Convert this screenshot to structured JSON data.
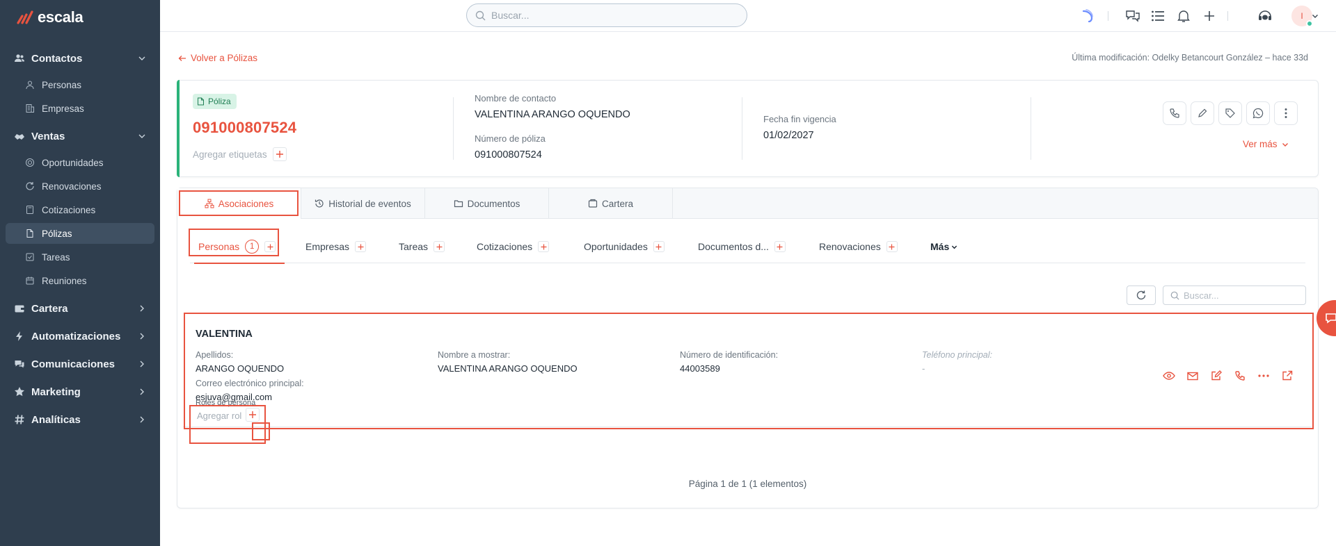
{
  "app": {
    "brand": "escala"
  },
  "search_top": {
    "placeholder": "Buscar..."
  },
  "sidebar": {
    "sections": [
      {
        "label": "Contactos",
        "icon": "users-icon",
        "expanded": true,
        "items": [
          {
            "label": "Personas",
            "icon": "user-icon"
          },
          {
            "label": "Empresas",
            "icon": "building-icon"
          }
        ]
      },
      {
        "label": "Ventas",
        "icon": "handshake-icon",
        "expanded": true,
        "items": [
          {
            "label": "Oportunidades",
            "icon": "target-icon"
          },
          {
            "label": "Renovaciones",
            "icon": "refresh-icon"
          },
          {
            "label": "Cotizaciones",
            "icon": "calculator-icon"
          },
          {
            "label": "Pólizas",
            "icon": "document-icon",
            "active": true
          },
          {
            "label": "Tareas",
            "icon": "checkbox-icon"
          },
          {
            "label": "Reuniones",
            "icon": "calendar-icon"
          }
        ]
      },
      {
        "label": "Cartera",
        "icon": "wallet-icon",
        "expanded": false,
        "items": []
      },
      {
        "label": "Automatizaciones",
        "icon": "bolt-icon",
        "expanded": false,
        "items": []
      },
      {
        "label": "Comunicaciones",
        "icon": "chat-icon",
        "expanded": false,
        "items": []
      },
      {
        "label": "Marketing",
        "icon": "star-icon",
        "expanded": false,
        "items": []
      },
      {
        "label": "Analíticas",
        "icon": "hash-icon",
        "expanded": false,
        "items": []
      }
    ]
  },
  "topbar": {
    "avatar_initial": "I"
  },
  "page": {
    "back_label": "Volver a Pólizas",
    "last_modified": "Última modificación: Odelky Betancourt González – hace 33d"
  },
  "policy": {
    "badge": "Póliza",
    "number_title": "091000807524",
    "add_tags": "Agregar etiquetas",
    "contact_label": "Nombre de contacto",
    "contact_value": "VALENTINA ARANGO OQUENDO",
    "policy_number_label": "Número de póliza",
    "policy_number_value": "091000807524",
    "end_date_label": "Fecha fin vigencia",
    "end_date_value": "01/02/2027",
    "ver_mas": "Ver más"
  },
  "main_tabs": [
    {
      "label": "Asociaciones",
      "active": true
    },
    {
      "label": "Historial de eventos"
    },
    {
      "label": "Documentos"
    },
    {
      "label": "Cartera"
    }
  ],
  "sub_tabs": [
    {
      "label": "Personas",
      "count": "1",
      "active": true
    },
    {
      "label": "Empresas"
    },
    {
      "label": "Tareas"
    },
    {
      "label": "Cotizaciones"
    },
    {
      "label": "Oportunidades"
    },
    {
      "label": "Documentos d..."
    },
    {
      "label": "Renovaciones"
    },
    {
      "label": "Más"
    }
  ],
  "list": {
    "search_placeholder": "Buscar..."
  },
  "person": {
    "name": "VALENTINA",
    "surname_label": "Apellidos:",
    "surname_value": "ARANGO OQUENDO",
    "display_label": "Nombre a mostrar:",
    "display_value": "VALENTINA ARANGO OQUENDO",
    "id_label": "Número de identificación:",
    "id_value": "44003589",
    "phone_label": "Teléfono principal:",
    "phone_value": "-",
    "email_label": "Correo electrónico principal:",
    "email_value": "esjuva@gmail.com",
    "roles_label": "Roles de persona",
    "add_role": "Agregar rol"
  },
  "pagination": {
    "text": "Página 1 de 1 (1 elementos)"
  },
  "colors": {
    "accent": "#e8533f",
    "sidebar": "#2f3e4e",
    "success": "#2bb37a"
  }
}
